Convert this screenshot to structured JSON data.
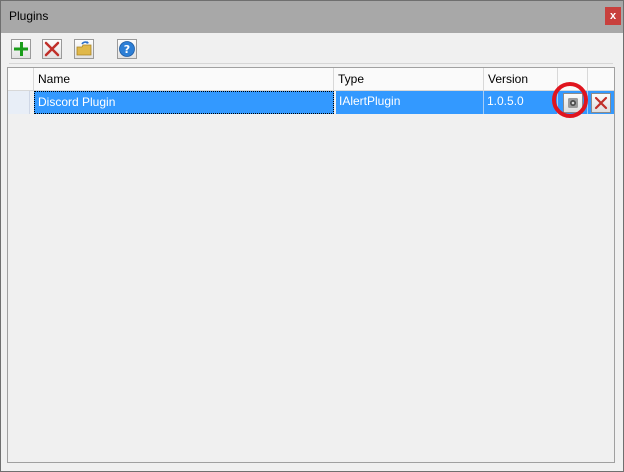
{
  "window": {
    "title": "Plugins",
    "close_label": "x"
  },
  "toolbar": {
    "buttons": [
      {
        "name": "add-plugin-button",
        "icon": "plus-icon"
      },
      {
        "name": "remove-plugin-button",
        "icon": "x-icon"
      },
      {
        "name": "load-plugin-button",
        "icon": "folder-icon"
      },
      {
        "name": "help-button",
        "icon": "question-icon"
      }
    ]
  },
  "grid": {
    "columns": [
      "Name",
      "Type",
      "Version"
    ],
    "rows": [
      {
        "name": "Discord Plugin",
        "type": "IAlertPlugin",
        "version": "1.0.5.0",
        "selected": true
      }
    ]
  },
  "colors": {
    "selection": "#3399ff",
    "highlight_circle": "#e0141e",
    "titlebar": "#a8a8a8",
    "close": "#c8403d"
  }
}
